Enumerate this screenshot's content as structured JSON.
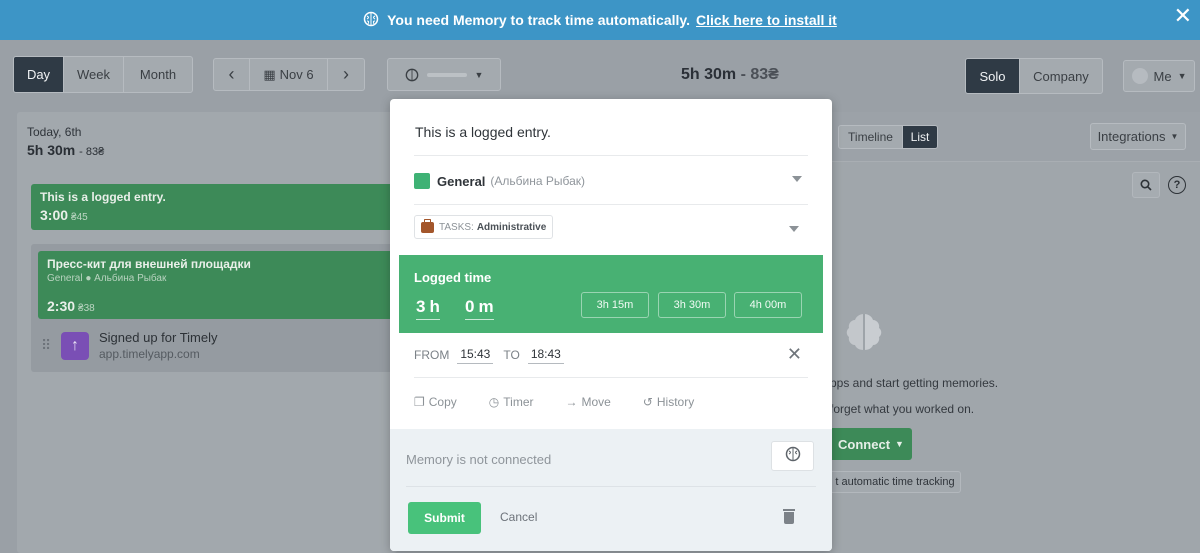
{
  "banner": {
    "message": "You need Memory to track time automatically.",
    "link": "Click here to install it",
    "close": "✕"
  },
  "toolbar": {
    "view_tabs": [
      "Day",
      "Week",
      "Month"
    ],
    "active_view": "Day",
    "prev": "‹",
    "next": "›",
    "date": "Nov 6",
    "total_time": "5h 30m",
    "total_money": "- 83₴",
    "scope_tabs": [
      "Solo",
      "Company"
    ],
    "active_scope": "Solo",
    "user": "Me"
  },
  "day": {
    "label": "Today, 6th",
    "total": "5h 30m",
    "money": "- 83₴",
    "entries": [
      {
        "title": "This is a logged entry.",
        "duration": "3:00",
        "money": "₴45"
      },
      {
        "title": "Пресс-кит для внешней площадки",
        "subtitle": "General ● Альбина Рыбак",
        "duration": "2:30",
        "money": "₴38"
      }
    ],
    "memory": {
      "name": "Signed up for Timely",
      "url": "app.timelyapp.com"
    }
  },
  "right": {
    "tabs": [
      "Timeline",
      "List"
    ],
    "active_tab": "List",
    "integrations": "Integrations",
    "line1": "pps and start getting memories.",
    "line2": "forget what you worked on.",
    "connect": "Connect",
    "autotrack": "t automatic time tracking"
  },
  "modal": {
    "title": "This is a logged entry.",
    "project_name": "General",
    "project_owner": "(Альбина Рыбак)",
    "tag_prefix": "TASKS:",
    "tag_value": "Administrative",
    "logged_label": "Logged time",
    "hours": "3",
    "hours_unit": "h",
    "minutes": "0",
    "minutes_unit": "m",
    "presets": [
      "3h 15m",
      "3h 30m",
      "4h 00m"
    ],
    "from_label": "FROM",
    "from_value": "15:43",
    "to_label": "TO",
    "to_value": "18:43",
    "actions": [
      "Copy",
      "Timer",
      "Move",
      "History"
    ],
    "memory_status": "Memory is not connected",
    "submit": "Submit",
    "cancel": "Cancel"
  },
  "colors": {
    "banner": "#3d95c6",
    "green": "#48b173",
    "submit": "#48c27b",
    "overlay": "#9aa0a6"
  }
}
